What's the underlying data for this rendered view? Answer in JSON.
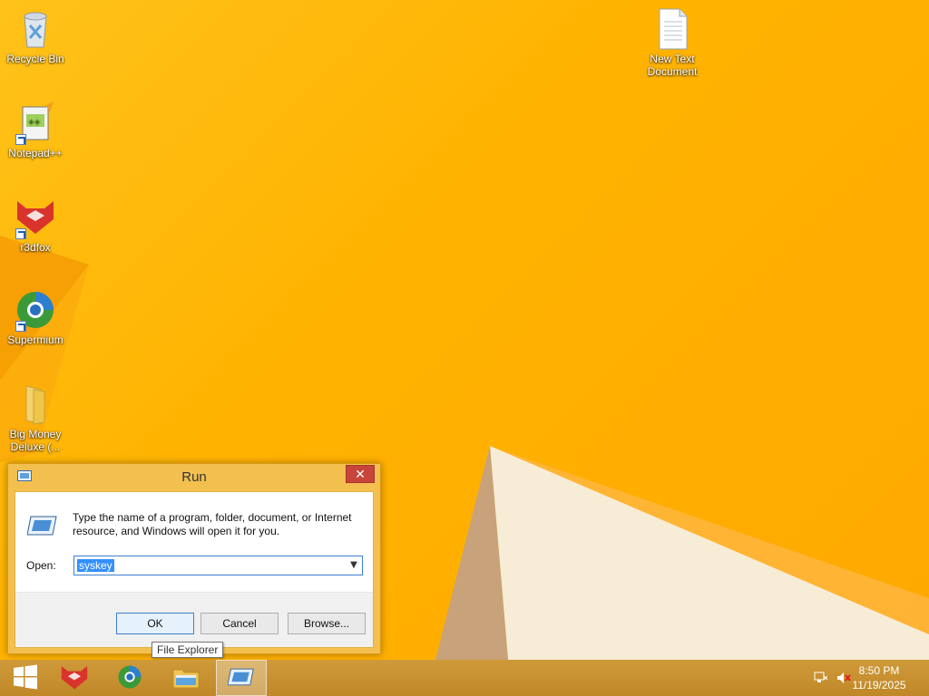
{
  "desktop": {
    "icons": [
      {
        "label": "Recycle Bin",
        "icon": "recycle-bin-icon"
      },
      {
        "label": "Notepad++",
        "icon": "notepad-plus-plus-icon"
      },
      {
        "label": "r3dfox",
        "icon": "r3dfox-icon"
      },
      {
        "label": "Supermium",
        "icon": "supermium-icon"
      },
      {
        "label": "Big Money Deluxe (...",
        "icon": "folder-icon"
      },
      {
        "label": "New Text Document",
        "icon": "text-document-icon"
      }
    ]
  },
  "run_dialog": {
    "title": "Run",
    "close_label": "✕",
    "description": "Type the name of a program, folder, document, or Internet resource, and Windows will open it for you.",
    "open_label": "Open:",
    "open_value": "syskey",
    "ok_label": "OK",
    "cancel_label": "Cancel",
    "browse_label": "Browse..."
  },
  "tooltip": {
    "text": "File Explorer"
  },
  "taskbar": {
    "buttons": [
      {
        "icon": "windows-start-icon"
      },
      {
        "icon": "r3dfox-icon"
      },
      {
        "icon": "supermium-icon"
      },
      {
        "icon": "file-explorer-icon"
      },
      {
        "icon": "run-icon",
        "active": true
      }
    ],
    "tray_icons": [
      "network-icon",
      "volume-muted-icon"
    ],
    "clock": {
      "time": "8:50 PM",
      "date": "11/19/2025"
    }
  },
  "colors": {
    "desktop_bg": "#ffb300",
    "taskbar": "#c98f2b",
    "dialog_frame": "#f3c04f",
    "close_button": "#c7453a",
    "selection": "#3390ff"
  }
}
